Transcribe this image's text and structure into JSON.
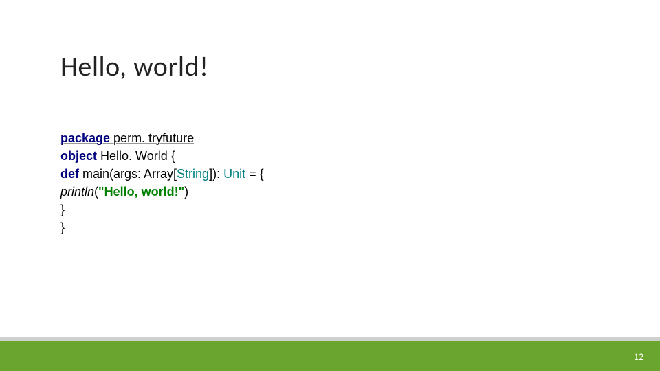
{
  "title": "Hello, world!",
  "code": {
    "line1": {
      "kw": "package",
      "rest": " perm. tryfuture"
    },
    "line2": "",
    "line3": {
      "kw": "object",
      "rest": " Hello. World {"
    },
    "line4": {
      "indent": "  ",
      "kw": "def",
      "sig1": " main(args: Array[",
      "type1": "String",
      "sig2": "]): ",
      "type2": "Unit",
      "sig3": " = {"
    },
    "line5": {
      "indent": "   ",
      "fn": "println",
      "open": "(",
      "str": "\"Hello, world!\"",
      "close": ")"
    },
    "line6": "  }",
    "line7": "}"
  },
  "page_number": "12",
  "colors": {
    "accent": "#6aa52e",
    "keyword": "#00007f",
    "type": "#008080",
    "string": "#008000"
  }
}
